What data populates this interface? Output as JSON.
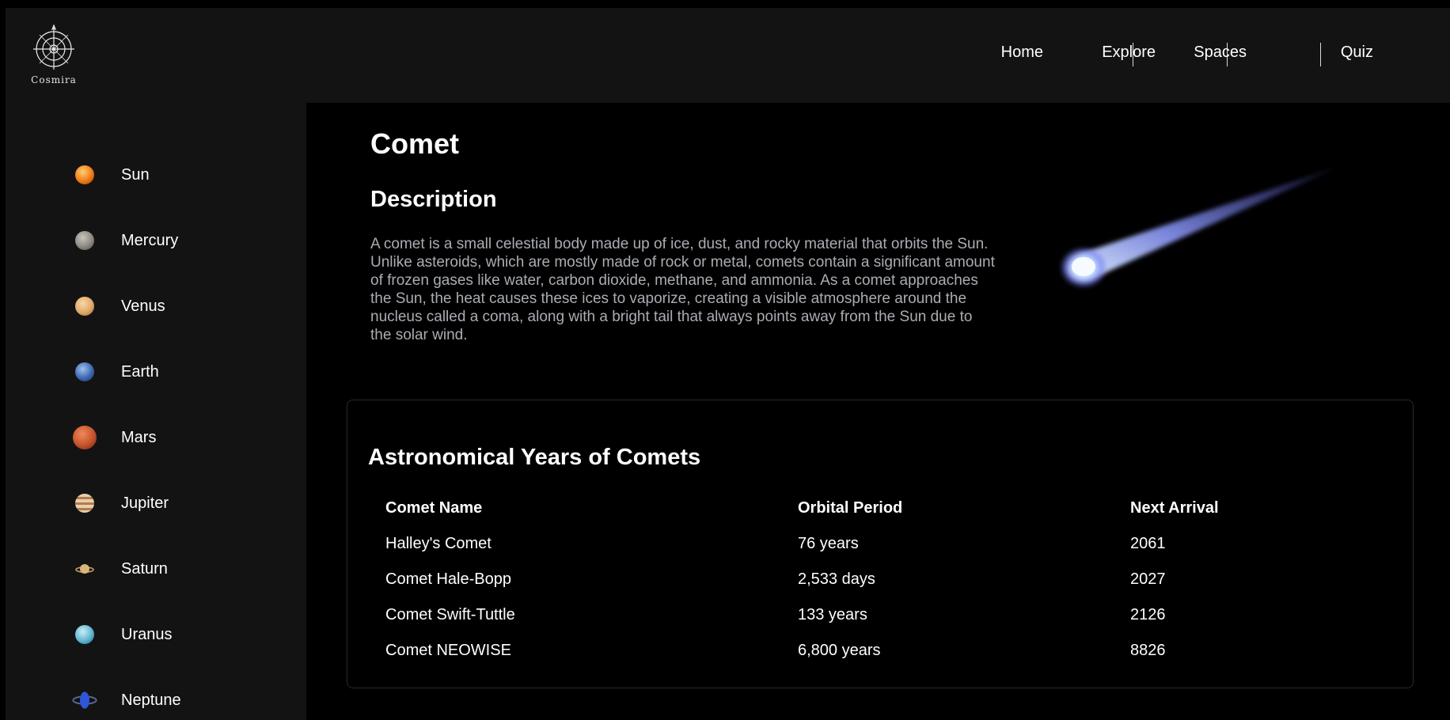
{
  "brand": {
    "name": "Cosmira",
    "logo_icon": "celestial-logo-icon"
  },
  "nav": [
    {
      "label": "Home"
    },
    {
      "label": "Explore"
    },
    {
      "label": "Spaces"
    },
    {
      "label": "Quiz"
    }
  ],
  "sidebar": {
    "items": [
      {
        "label": "Sun",
        "icon": "sun-icon",
        "color": "#f07a18"
      },
      {
        "label": "Mercury",
        "icon": "mercury-icon",
        "color": "#8d8982"
      },
      {
        "label": "Venus",
        "icon": "venus-icon",
        "color": "#e0a868"
      },
      {
        "label": "Earth",
        "icon": "earth-icon",
        "color": "#3c68b2"
      },
      {
        "label": "Mars",
        "icon": "mars-icon",
        "color": "#c4522c"
      },
      {
        "label": "Jupiter",
        "icon": "jupiter-icon",
        "color": "#c9a27a"
      },
      {
        "label": "Saturn",
        "icon": "saturn-icon",
        "color": "#d8b57a"
      },
      {
        "label": "Uranus",
        "icon": "uranus-icon",
        "color": "#5fb6d0"
      },
      {
        "label": "Neptune",
        "icon": "neptune-icon",
        "color": "#2f55d9"
      }
    ]
  },
  "main": {
    "title": "Comet",
    "description_heading": "Description",
    "description": "A comet is a small celestial body made up of ice, dust, and rocky material that orbits the Sun. Unlike asteroids, which are mostly made of rock or metal, comets contain a significant amount of frozen gases like water, carbon dioxide, methane, and ammonia. As a comet approaches the Sun, the heat causes these ices to vaporize, creating a visible atmosphere around the nucleus called a coma, along with a bright tail that always points away from the Sun due to the solar wind.",
    "image_icon": "comet-icon"
  },
  "comet_table": {
    "title": "Astronomical Years of Comets",
    "headers": [
      "Comet Name",
      "Orbital Period",
      "Next Arrival"
    ],
    "rows": [
      [
        "Halley's Comet",
        "76 years",
        "2061"
      ],
      [
        "Comet Hale-Bopp",
        "2,533 days",
        "2027"
      ],
      [
        "Comet Swift-Tuttle",
        "133 years",
        "2126"
      ],
      [
        "Comet NEOWISE",
        "6,800 years",
        "8826"
      ]
    ]
  },
  "colors": {
    "header_bg": "#141314",
    "page_bg": "#000000",
    "description_text": "#a9adb3",
    "comet_glow": "#8f9bff"
  }
}
